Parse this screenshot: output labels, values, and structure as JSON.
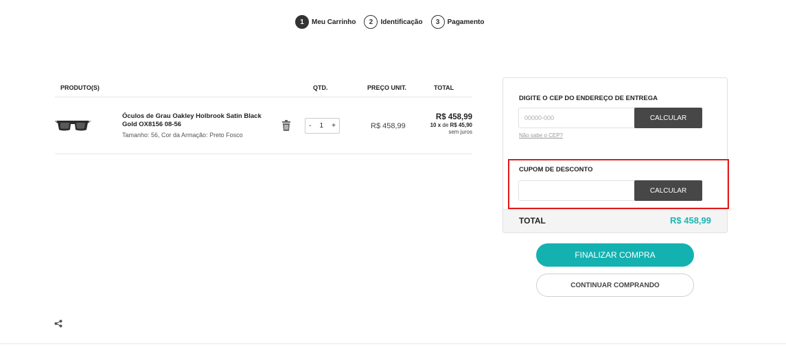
{
  "steps": [
    {
      "num": "1",
      "label": "Meu Carrinho",
      "active": true
    },
    {
      "num": "2",
      "label": "Identificação",
      "active": false
    },
    {
      "num": "3",
      "label": "Pagamento",
      "active": false
    }
  ],
  "table": {
    "headers": {
      "product": "PRODUTO(S)",
      "qty": "QTD.",
      "unit": "PREÇO UNIT.",
      "total": "TOTAL"
    },
    "items": [
      {
        "name": "Óculos de Grau Oakley Holbrook Satin Black Gold OX8156 08-56",
        "attributes": "Tamanho: 56, Cor da Armação: Preto Fosco",
        "qty_minus": "-",
        "qty": "1",
        "qty_plus": "+",
        "unit_price": "R$ 458,99",
        "total": "R$ 458,99",
        "installments_count": "10 x",
        "installments_of": "de",
        "installment_value": "R$ 45,90",
        "installments_note": "sem juros"
      }
    ]
  },
  "shipping": {
    "title": "DIGITE O CEP DO ENDEREÇO DE ENTREGA",
    "placeholder": "00000-000",
    "button": "CALCULAR",
    "help_link": "Não sabe o CEP?"
  },
  "coupon": {
    "title": "CUPOM DE DESCONTO",
    "value": "",
    "button": "CALCULAR"
  },
  "summary": {
    "total_label": "TOTAL",
    "total_value": "R$ 458,99"
  },
  "actions": {
    "checkout": "FINALIZAR COMPRA",
    "continue": "CONTINUAR COMPRANDO"
  },
  "colors": {
    "accent": "#14b1b1",
    "total_text": "#1fb5b5",
    "dark_button": "#474747",
    "highlight_border": "#e01818"
  },
  "icons": {
    "trash": "trash-icon",
    "share": "share-icon",
    "product": "eyeglasses-thumbnail"
  }
}
